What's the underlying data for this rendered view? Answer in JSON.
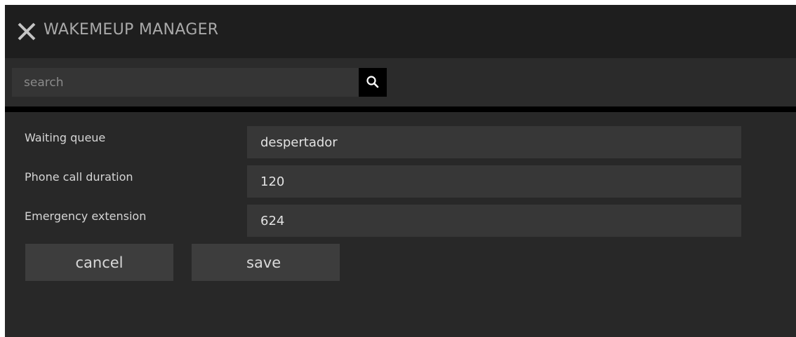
{
  "header": {
    "title": "WAKEMEUP MANAGER",
    "close_icon": "close-icon"
  },
  "search": {
    "placeholder": "search",
    "value": "",
    "icon": "search-icon"
  },
  "form": {
    "waiting_queue": {
      "label": "Waiting queue",
      "value": "despertador"
    },
    "phone_call_duration": {
      "label": "Phone call duration",
      "value": "120"
    },
    "emergency_extension": {
      "label": "Emergency extension",
      "value": "624"
    }
  },
  "actions": {
    "cancel_label": "cancel",
    "save_label": "save"
  },
  "colors": {
    "window_bg": "#282828",
    "titlebar_bg": "#1e1e1e",
    "field_bg": "#373737",
    "button_bg": "#3d3d3d",
    "search_button_bg": "#000000"
  }
}
